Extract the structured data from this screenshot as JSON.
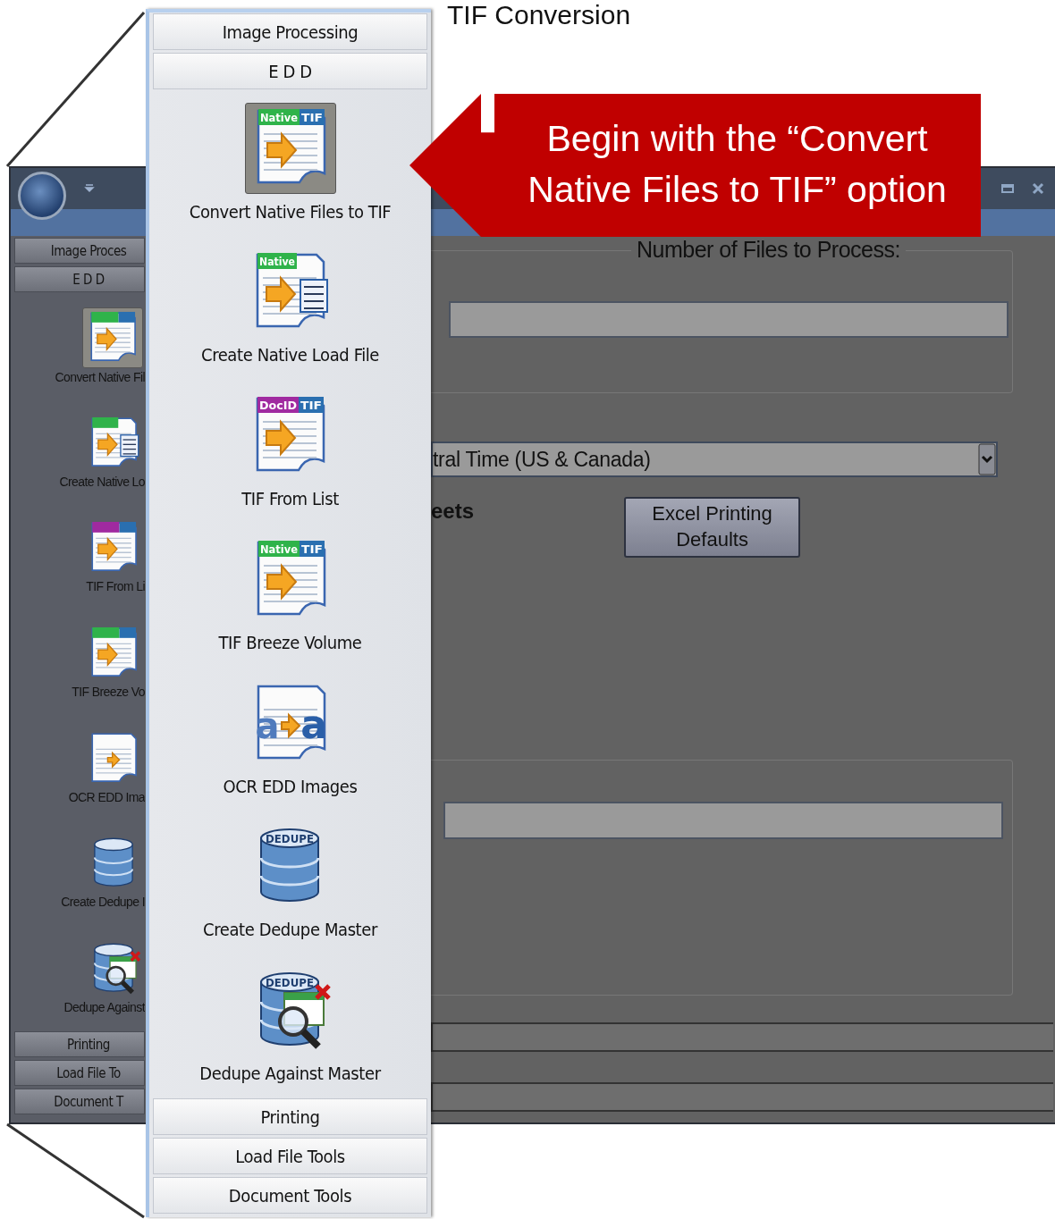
{
  "slide_title": "TIF Conversion",
  "sidebar": {
    "headers_top": [
      "Image Proces",
      "E D D"
    ],
    "items": [
      {
        "label": "Convert Native Fil",
        "kind": "doc",
        "selected": true,
        "tags": [
          {
            "color": "#2fb34a"
          },
          {
            "color": "#2a6fb0"
          }
        ]
      },
      {
        "label": "Create Native Lo",
        "kind": "load",
        "selected": false,
        "tags": [
          {
            "color": "#2fb34a"
          }
        ]
      },
      {
        "label": "TIF From Li",
        "kind": "doc",
        "selected": false,
        "tags": [
          {
            "color": "#a02aa0"
          },
          {
            "color": "#2a6fb0"
          }
        ]
      },
      {
        "label": "TIF Breeze Vo",
        "kind": "doc",
        "selected": false,
        "tags": [
          {
            "color": "#2fb34a"
          },
          {
            "color": "#2a6fb0"
          }
        ]
      },
      {
        "label": "OCR EDD Ima",
        "kind": "ocr",
        "selected": false
      },
      {
        "label": "Create Dedupe I",
        "kind": "db",
        "selected": false
      },
      {
        "label": "Dedupe Against",
        "kind": "dbsearch",
        "selected": false
      }
    ],
    "headers_bottom": [
      "Printing",
      "Load File To",
      "Document T"
    ]
  },
  "content": {
    "group_legend": "Number of Files to Process:",
    "timezone_dropdown": {
      "value": "tral Time (US & Canada)"
    },
    "sheets_label": "eets",
    "excel_button": "Excel Printing Defaults",
    "progress_bars": [
      {
        "level": 0
      },
      {
        "level": 0
      }
    ]
  },
  "panel": {
    "headers_top": [
      "Image Processing",
      "E D D"
    ],
    "items": [
      {
        "label": "Convert Native Files to TIF",
        "kind": "doc",
        "selected": true,
        "tags": [
          {
            "text": "Native",
            "color": "#2fb34a"
          },
          {
            "text": "TIF",
            "color": "#2a6fb0"
          }
        ]
      },
      {
        "label": "Create Native Load File",
        "kind": "load",
        "selected": false,
        "tags": [
          {
            "text": "Native",
            "color": "#2fb34a"
          }
        ]
      },
      {
        "label": "TIF From List",
        "kind": "doc",
        "selected": false,
        "tags": [
          {
            "text": "DocID",
            "color": "#a02aa0"
          },
          {
            "text": "TIF",
            "color": "#2a6fb0"
          }
        ]
      },
      {
        "label": "TIF Breeze Volume",
        "kind": "doc",
        "selected": false,
        "tags": [
          {
            "text": "Native",
            "color": "#2fb34a"
          },
          {
            "text": "TIF",
            "color": "#2a6fb0"
          }
        ]
      },
      {
        "label": "OCR EDD Images",
        "kind": "ocr",
        "selected": false,
        "tags": [
          {
            "text": "a"
          },
          {
            "text": "a"
          }
        ]
      },
      {
        "label": "Create Dedupe Master",
        "kind": "db",
        "selected": false,
        "tags": [
          {
            "text": "DEDUPE"
          }
        ]
      },
      {
        "label": "Dedupe Against Master",
        "kind": "dbsearch",
        "selected": false,
        "tags": [
          {
            "text": "DEDUPE"
          }
        ]
      }
    ],
    "headers_bottom": [
      "Printing",
      "Load File Tools",
      "Document Tools"
    ]
  },
  "callout": "Begin with the “Convert Native Files to TIF” option"
}
